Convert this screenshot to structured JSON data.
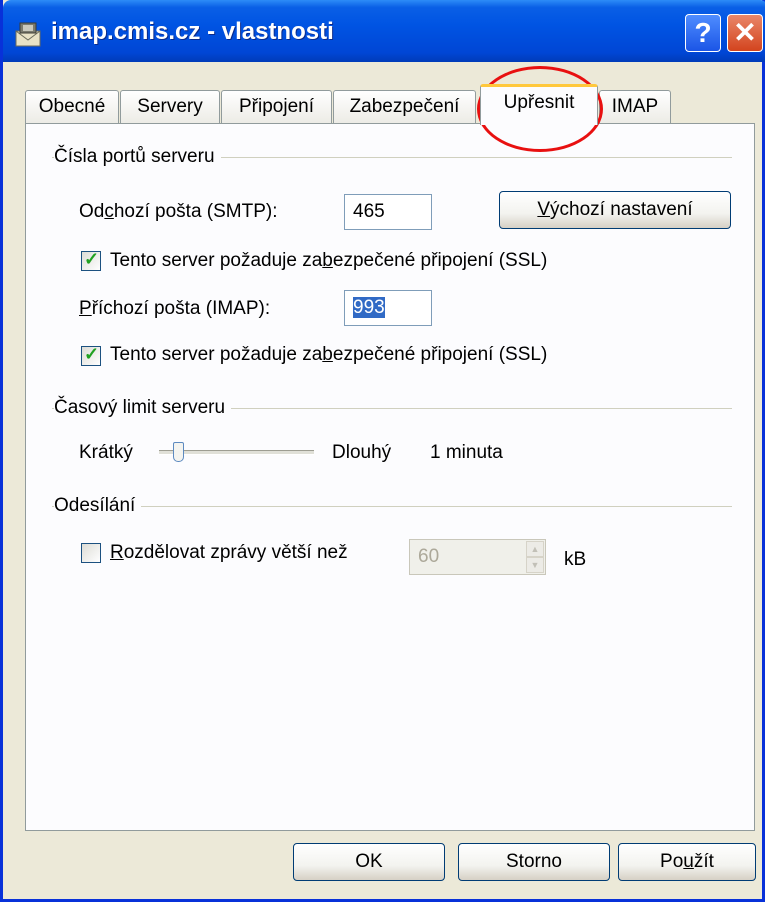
{
  "window": {
    "title": "imap.cmis.cz - vlastnosti"
  },
  "titlebar_buttons": {
    "help_label": "?",
    "close_label": "✕"
  },
  "tabs": [
    {
      "label": "Obecné"
    },
    {
      "label": "Servery"
    },
    {
      "label": "Připojení"
    },
    {
      "label": "Zabezpečení"
    },
    {
      "label": "Upřesnit"
    },
    {
      "label": "IMAP"
    }
  ],
  "ports": {
    "group_label": "Čísla portů serveru",
    "smtp_label_pre": "Od",
    "smtp_label_u": "c",
    "smtp_label_post": "hozí pošta (SMTP):",
    "smtp_value": "465",
    "default_button_u": "V",
    "default_button_post": "ýchozí nastavení",
    "ssl1_pre": "Tento server požaduje za",
    "ssl1_u": "b",
    "ssl1_post": "ezpečené připojení (SSL)",
    "imap_label_u": "P",
    "imap_label_post": "říchozí pošta (IMAP):",
    "imap_value": "993",
    "ssl2_pre": "Tento server požaduje za",
    "ssl2_u": "b",
    "ssl2_post": "ezpečené připojení (SSL)"
  },
  "timeout": {
    "group_label": "Časový limit serveru",
    "short_label": "Krátký",
    "long_label": "Dlouhý",
    "value_text": "1 minuta",
    "slider_level": 0.1
  },
  "sending": {
    "group_label": "Odesílání",
    "split_label_u": "R",
    "split_label_post": "ozdělovat zprávy větší než",
    "split_value": "60",
    "unit": "kB"
  },
  "buttons": {
    "ok": "OK",
    "cancel": "Storno",
    "apply_pre": "Po",
    "apply_u": "u",
    "apply_post": "žít"
  },
  "colors": {
    "title_bar": "#0054e3",
    "checkbox_check": "#21a121",
    "annotation_circle": "#e81010"
  }
}
